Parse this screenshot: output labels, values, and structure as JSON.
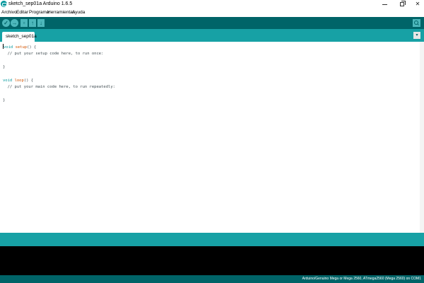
{
  "window": {
    "title": "sketch_sep01a Arduino 1.6.5",
    "minimize_glyph": "",
    "close_glyph": "✕"
  },
  "menu": [
    "Archivo",
    "Editar",
    "Programa",
    "Herramientas",
    "Ayuda"
  ],
  "toolbar": {
    "verify_glyph": "✓",
    "upload_glyph": "→",
    "new_glyph": "▫",
    "open_glyph": "↑",
    "save_glyph": "↓",
    "icons": [
      "check-icon",
      "arrow-right-icon",
      "new-file-icon",
      "open-icon",
      "save-icon",
      "serial-monitor-icon"
    ]
  },
  "tabs": [
    {
      "label": "sketch_sep01a"
    }
  ],
  "tab_menu_glyph": "▾",
  "code": {
    "line1_kw": "void",
    "line1_fn": "setup",
    "line1_rest": "() {",
    "line2": "  // put your setup code here, to run once:",
    "line3": "",
    "line4": "}",
    "line5": "",
    "line6_kw": "void",
    "line6_fn": "loop",
    "line6_rest": "() {",
    "line7": "  // put your main code here, to run repeatedly:",
    "line8": "",
    "line9": "}"
  },
  "footer": {
    "board": "Arduino/Genuino Mega or Mega 2560, ATmega2560 (Mega 2560) on COM1"
  },
  "colors": {
    "toolbar": "#006468",
    "tabbar": "#17a1a5",
    "accent": "#00979c",
    "console": "#000000"
  }
}
